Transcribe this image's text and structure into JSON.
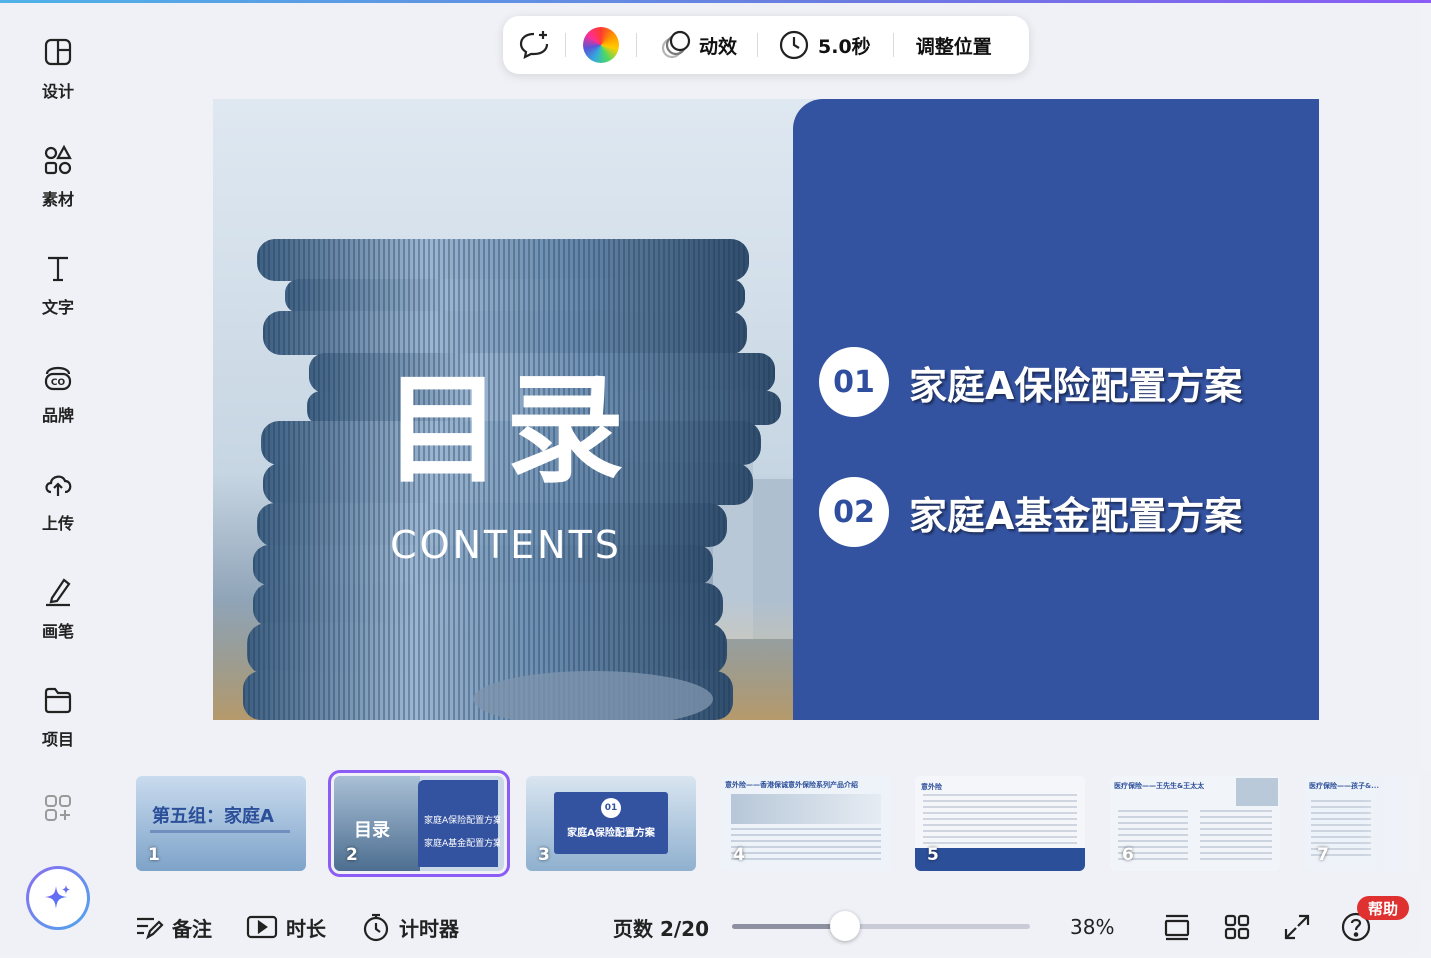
{
  "toolbar": {
    "animation_label": "动效",
    "duration_label": "5.0秒",
    "position_label": "调整位置"
  },
  "sidebar": {
    "items": [
      {
        "label": "设计",
        "icon": "layout-icon"
      },
      {
        "label": "素材",
        "icon": "shapes-icon"
      },
      {
        "label": "文字",
        "icon": "text-icon"
      },
      {
        "label": "品牌",
        "icon": "brand-icon"
      },
      {
        "label": "上传",
        "icon": "upload-cloud-icon"
      },
      {
        "label": "画笔",
        "icon": "draw-icon"
      },
      {
        "label": "项目",
        "icon": "folder-icon"
      }
    ]
  },
  "slide": {
    "title": "目录",
    "subtitle": "CONTENTS",
    "items": [
      {
        "num": "01",
        "text": "家庭A保险配置方案"
      },
      {
        "num": "02",
        "text": "家庭A基金配置方案"
      }
    ],
    "colors": {
      "panel": "#3352a0",
      "number": "#2f4f9e"
    }
  },
  "thumbnails": [
    {
      "num": "1",
      "title": "第五组：家庭A"
    },
    {
      "num": "2",
      "title": "目录",
      "line1": "家庭A保险配置方案",
      "line2": "家庭A基金配置方案",
      "selected": true
    },
    {
      "num": "3",
      "badge": "01",
      "title": "家庭A保险配置方案"
    },
    {
      "num": "4",
      "title": "意外险——香港保诚意外保险系列产品介绍"
    },
    {
      "num": "5",
      "title": "意外险"
    },
    {
      "num": "6",
      "title": "医疗保险——王先生&王太太"
    },
    {
      "num": "7",
      "title": "医疗保险——孩子&..."
    }
  ],
  "bottom": {
    "notes_label": "备注",
    "duration_label": "时长",
    "timer_label": "计时器",
    "page_label": "页数 2/20",
    "zoom_level": 0.38,
    "zoom_label": "38%",
    "help_label": "帮助"
  }
}
